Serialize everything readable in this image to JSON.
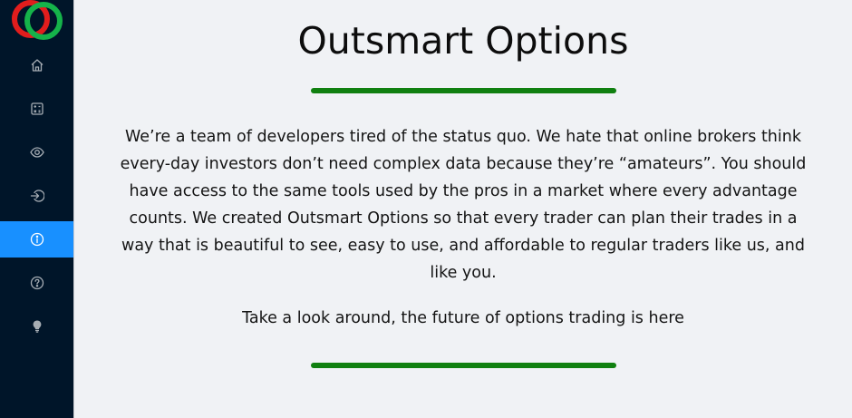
{
  "sidebar": {
    "logo": "outsmart-options-logo",
    "items": [
      {
        "icon": "home-icon",
        "active": false
      },
      {
        "icon": "calculator-icon",
        "active": false
      },
      {
        "icon": "eye-icon",
        "active": false
      },
      {
        "icon": "login-icon",
        "active": false
      },
      {
        "icon": "info-icon",
        "active": true
      },
      {
        "icon": "question-icon",
        "active": false
      },
      {
        "icon": "lightbulb-icon",
        "active": false
      }
    ],
    "active_color": "#1890ff",
    "background": "#001529"
  },
  "main": {
    "title": "Outsmart Options",
    "description": "We’re a team of developers tired of the status quo. We hate that online brokers think every-day investors don’t need complex data because they’re “amateurs”. You should have access to the same tools used by the pros in a market where every advantage counts. We created Outsmart Options so that every trader can plan their trades in a way that is beautiful to see, easy to use, and affordable to regular traders like us, and like you.",
    "tagline": "Take a look around, the future of options trading is here",
    "divider_color": "#108010"
  }
}
